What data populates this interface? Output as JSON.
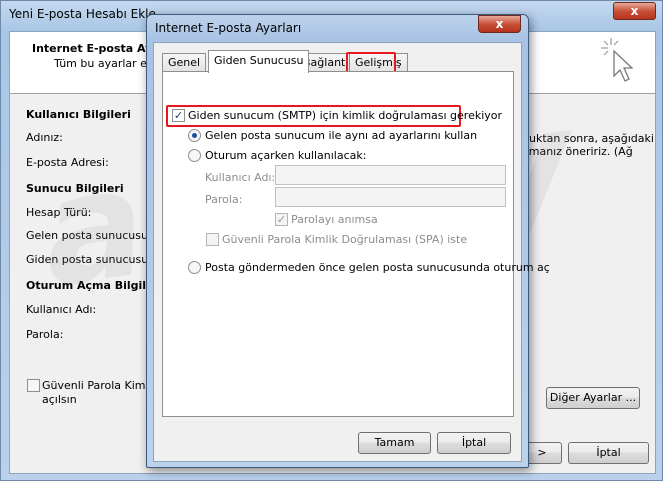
{
  "background_window": {
    "title": "Yeni E-posta Hesabı Ekle",
    "close_glyph": "x",
    "header_title": "Internet E-posta Aya",
    "header_subtitle": "Tüm bu ayarlar e-po",
    "user_section": "Kullanıcı Bilgileri",
    "name_label": "Adınız:",
    "email_label": "E-posta Adresi:",
    "server_section": "Sunucu Bilgileri",
    "account_type_label": "Hesap Türü:",
    "incoming_label": "Gelen posta sunucusu:",
    "outgoing_label": "Giden posta sunucusu (SMTI",
    "logon_section": "Oturum Açma Bilgileri",
    "username_label": "Kullanıcı Adı:",
    "password_label": "Parola:",
    "right_text_line1": "duktan sonra, aşağıdaki",
    "right_text_line2": "amanız öneririz. (Ağ",
    "spa_label_line1": "Güvenli Parola Kimlik D",
    "spa_label_line2": "açılsın",
    "more_settings_button": "Diğer Ayarlar ...",
    "next_button_glyph": ">",
    "cancel_button": "İptal",
    "watermark": "alasty"
  },
  "dialog": {
    "title": "Internet E-posta Ayarları",
    "close_glyph": "x",
    "tabs": [
      {
        "label": "Genel"
      },
      {
        "label": "Giden Sunucusu"
      },
      {
        "label": "Bağlantı"
      },
      {
        "label": "Gelişmiş"
      }
    ],
    "smtp_auth_label": "Giden sunucum (SMTP) için kimlik doğrulaması gerekiyor",
    "smtp_auth_checked": true,
    "same_settings_label": "Gelen posta sunucum ile aynı ad ayarlarını kullan",
    "logon_using_label": "Oturum açarken kullanılacak:",
    "username_label": "Kullanıcı Adı:",
    "password_label": "Parola:",
    "remember_password_label": "Parolayı anımsa",
    "spa_label": "Güvenli Parola Kimlik Doğrulaması (SPA) iste",
    "logon_before_label": "Posta göndermeden önce gelen posta sunucusunda oturum aç",
    "ok_button": "Tamam",
    "cancel_button": "İptal",
    "highlight_color": "#e8171d",
    "check_glyph": "✓"
  }
}
